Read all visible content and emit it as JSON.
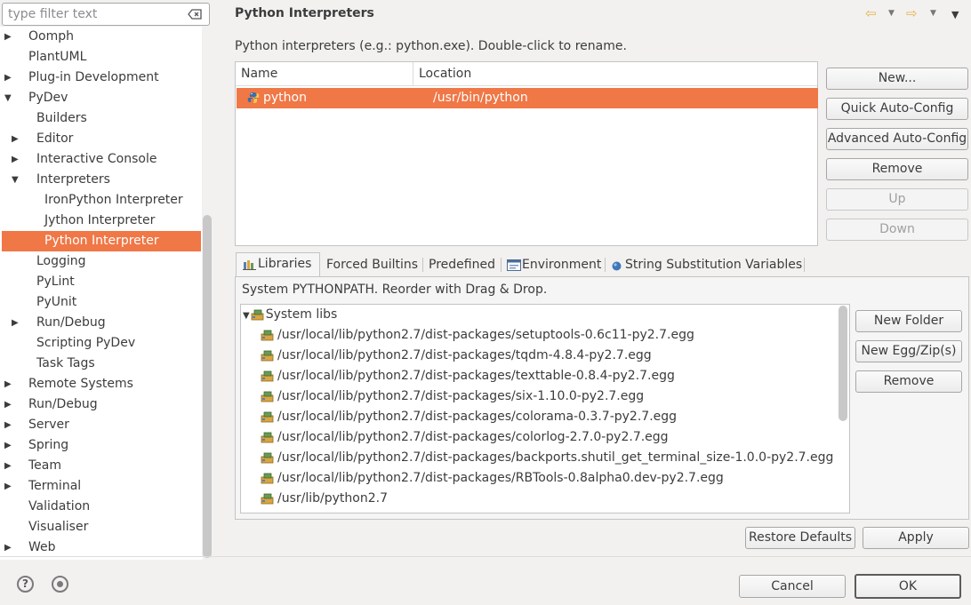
{
  "filter": {
    "placeholder": "type filter text"
  },
  "tree": [
    {
      "label": "Oomph",
      "arrow": "▶",
      "level": 0
    },
    {
      "label": "PlantUML",
      "arrow": "",
      "level": 0
    },
    {
      "label": "Plug-in Development",
      "arrow": "▶",
      "level": 0
    },
    {
      "label": "PyDev",
      "arrow": "▼",
      "level": 0
    },
    {
      "label": "Builders",
      "arrow": "",
      "level": 1
    },
    {
      "label": "Editor",
      "arrow": "▶",
      "level": 1
    },
    {
      "label": "Interactive Console",
      "arrow": "▶",
      "level": 1
    },
    {
      "label": "Interpreters",
      "arrow": "▼",
      "level": 1
    },
    {
      "label": "IronPython Interpreter",
      "arrow": "",
      "level": 2
    },
    {
      "label": "Jython Interpreter",
      "arrow": "",
      "level": 2
    },
    {
      "label": "Python Interpreter",
      "arrow": "",
      "level": 2,
      "selected": true
    },
    {
      "label": "Logging",
      "arrow": "",
      "level": 1
    },
    {
      "label": "PyLint",
      "arrow": "",
      "level": 1
    },
    {
      "label": "PyUnit",
      "arrow": "",
      "level": 1
    },
    {
      "label": "Run/Debug",
      "arrow": "▶",
      "level": 1
    },
    {
      "label": "Scripting PyDev",
      "arrow": "",
      "level": 1
    },
    {
      "label": "Task Tags",
      "arrow": "",
      "level": 1
    },
    {
      "label": "Remote Systems",
      "arrow": "▶",
      "level": 0
    },
    {
      "label": "Run/Debug",
      "arrow": "▶",
      "level": 0
    },
    {
      "label": "Server",
      "arrow": "▶",
      "level": 0
    },
    {
      "label": "Spring",
      "arrow": "▶",
      "level": 0
    },
    {
      "label": "Team",
      "arrow": "▶",
      "level": 0
    },
    {
      "label": "Terminal",
      "arrow": "▶",
      "level": 0
    },
    {
      "label": "Validation",
      "arrow": "",
      "level": 0
    },
    {
      "label": "Visualiser",
      "arrow": "",
      "level": 0
    },
    {
      "label": "Web",
      "arrow": "▶",
      "level": 0
    }
  ],
  "page": {
    "title": "Python Interpreters",
    "description": "Python interpreters (e.g.: python.exe).  Double-click to rename."
  },
  "interpreters": {
    "columns": [
      "Name",
      "Location"
    ],
    "rows": [
      {
        "name": "python",
        "location": "/usr/bin/python"
      }
    ]
  },
  "interp_buttons": {
    "new": "New...",
    "quick": "Quick Auto-Config",
    "advanced": "Advanced Auto-Config",
    "remove": "Remove",
    "up": "Up",
    "down": "Down"
  },
  "tabs": [
    {
      "label": "Libraries",
      "icon": "libraries-icon"
    },
    {
      "label": "Forced Builtins"
    },
    {
      "label": "Predefined"
    },
    {
      "label": "Environment",
      "icon": "environment-icon"
    },
    {
      "label": "String Substitution Variables",
      "icon": "variables-icon"
    }
  ],
  "libraries": {
    "description": "System PYTHONPATH.  Reorder with Drag & Drop.",
    "root": "System libs",
    "items": [
      "/usr/local/lib/python2.7/dist-packages/setuptools-0.6c11-py2.7.egg",
      "/usr/local/lib/python2.7/dist-packages/tqdm-4.8.4-py2.7.egg",
      "/usr/local/lib/python2.7/dist-packages/texttable-0.8.4-py2.7.egg",
      "/usr/local/lib/python2.7/dist-packages/six-1.10.0-py2.7.egg",
      "/usr/local/lib/python2.7/dist-packages/colorama-0.3.7-py2.7.egg",
      "/usr/local/lib/python2.7/dist-packages/colorlog-2.7.0-py2.7.egg",
      "/usr/local/lib/python2.7/dist-packages/backports.shutil_get_terminal_size-1.0.0-py2.7.egg",
      "/usr/local/lib/python2.7/dist-packages/RBTools-0.8alpha0.dev-py2.7.egg",
      "/usr/lib/python2.7"
    ],
    "buttons": {
      "new_folder": "New Folder",
      "new_egg": "New Egg/Zip(s)",
      "remove": "Remove"
    }
  },
  "footer": {
    "restore_defaults": "Restore Defaults",
    "apply": "Apply",
    "cancel": "Cancel",
    "ok": "OK",
    "help_glyph": "?"
  },
  "colors": {
    "selection": "#f07746",
    "background": "#f2f1f0"
  }
}
